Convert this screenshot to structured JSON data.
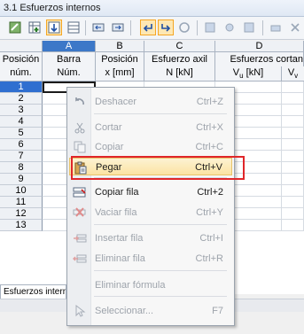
{
  "window": {
    "title": "3.1 Esfuerzos internos"
  },
  "table": {
    "col_letters": [
      "A",
      "B",
      "C",
      "D"
    ],
    "header_row1": {
      "rowhead": "Posición",
      "a": "Barra",
      "b": "Posición",
      "c": "Esfuerzo axil",
      "d": "Esfuerzos cortan"
    },
    "header_row2": {
      "rowhead": "núm.",
      "a": "Núm.",
      "b": "x [mm]",
      "c": "N [kN]",
      "d": "V",
      "d_sub": "u",
      "d_unit": " [kN]",
      "e": "V",
      "e_sub": "v"
    },
    "rows": [
      "1",
      "2",
      "3",
      "4",
      "5",
      "6",
      "7",
      "8",
      "9",
      "10",
      "11",
      "12",
      "13"
    ],
    "selected_row": "1"
  },
  "status": {
    "tab": "Esfuerzos intern"
  },
  "context_menu": {
    "items": [
      {
        "label": "Deshacer",
        "shortcut": "Ctrl+Z",
        "enabled": false,
        "icon": "undo-icon"
      },
      {
        "label": "Cortar",
        "shortcut": "Ctrl+X",
        "enabled": false,
        "icon": "scissors-icon"
      },
      {
        "label": "Copiar",
        "shortcut": "Ctrl+C",
        "enabled": false,
        "icon": "copy-icon"
      },
      {
        "label": "Pegar",
        "shortcut": "Ctrl+V",
        "enabled": true,
        "highlighted": true,
        "icon": "paste-icon"
      },
      {
        "label": "Copiar fila",
        "shortcut": "Ctrl+2",
        "enabled": true,
        "icon": "copy-row-icon"
      },
      {
        "label": "Vaciar fila",
        "shortcut": "Ctrl+Y",
        "enabled": false,
        "icon": "clear-row-icon"
      },
      {
        "label": "Insertar fila",
        "shortcut": "Ctrl+I",
        "enabled": false,
        "icon": "insert-row-icon"
      },
      {
        "label": "Eliminar fila",
        "shortcut": "Ctrl+R",
        "enabled": false,
        "icon": "delete-row-icon"
      },
      {
        "label": "Eliminar fórmula",
        "shortcut": "",
        "enabled": false,
        "icon": ""
      },
      {
        "label": "Seleccionar...",
        "shortcut": "F7",
        "enabled": false,
        "icon": "select-pointer-icon"
      }
    ]
  },
  "colors": {
    "highlight_border": "#e0262a",
    "selection": "#2f6fd0",
    "menu_highlight": "#fbe3a3"
  }
}
